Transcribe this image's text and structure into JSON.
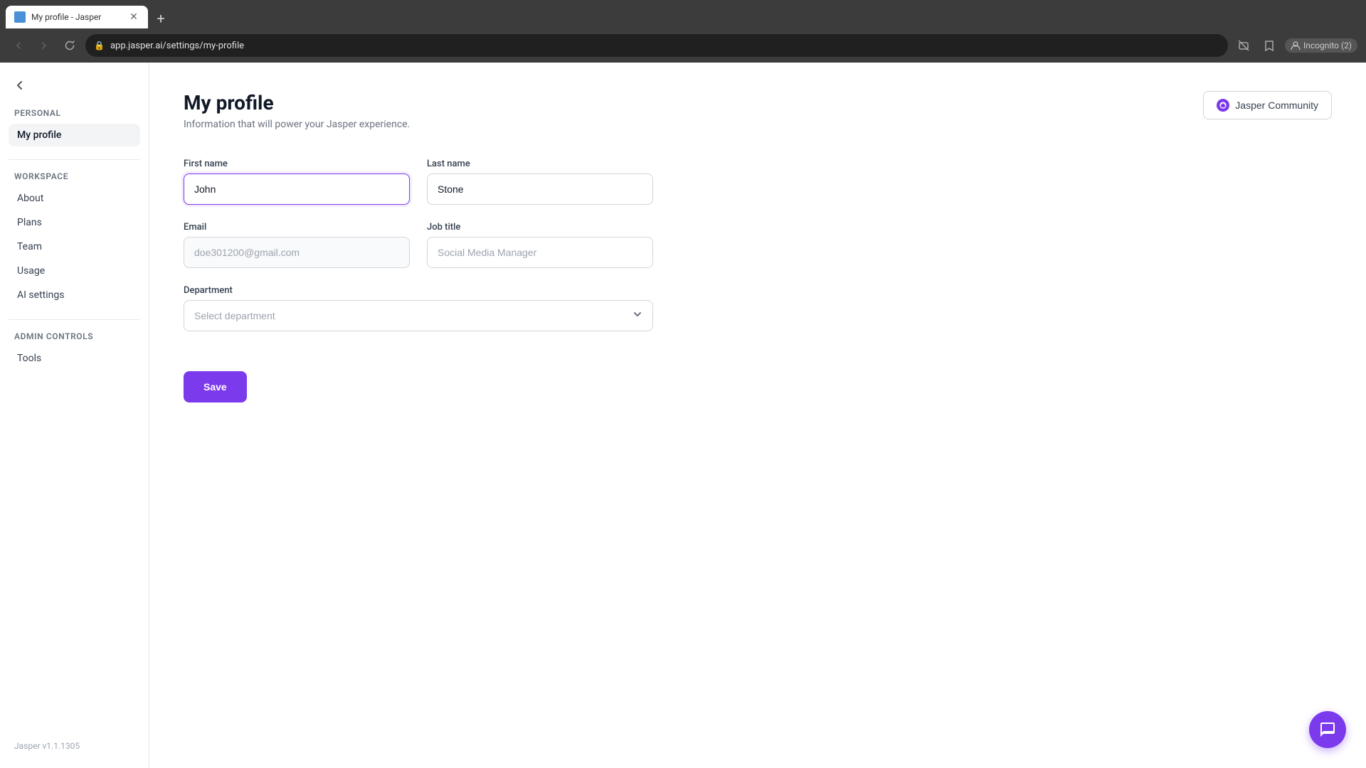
{
  "browser": {
    "tab_title": "My profile - Jasper",
    "url": "app.jasper.ai/settings/my-profile",
    "incognito_label": "Incognito (2)"
  },
  "sidebar": {
    "back_label": "←",
    "personal_label": "Personal",
    "workspace_label": "Workspace",
    "admin_label": "Admin controls",
    "items_personal": [
      {
        "id": "my-profile",
        "label": "My profile",
        "active": true
      }
    ],
    "items_workspace": [
      {
        "id": "about",
        "label": "About",
        "active": false
      },
      {
        "id": "plans",
        "label": "Plans",
        "active": false
      },
      {
        "id": "team",
        "label": "Team",
        "active": false
      },
      {
        "id": "usage",
        "label": "Usage",
        "active": false
      },
      {
        "id": "ai-settings",
        "label": "AI settings",
        "active": false
      }
    ],
    "items_admin": [
      {
        "id": "tools",
        "label": "Tools",
        "active": false
      }
    ],
    "footer": "Jasper v1.1.1305"
  },
  "page": {
    "title": "My profile",
    "subtitle": "Information that will power your Jasper experience.",
    "community_button": "Jasper Community"
  },
  "form": {
    "first_name_label": "First name",
    "first_name_value": "John",
    "last_name_label": "Last name",
    "last_name_value": "Stone",
    "email_label": "Email",
    "email_placeholder": "doe301200@gmail.com",
    "job_title_label": "Job title",
    "job_title_placeholder": "Social Media Manager",
    "department_label": "Department",
    "department_placeholder": "Select department",
    "save_button": "Save"
  }
}
